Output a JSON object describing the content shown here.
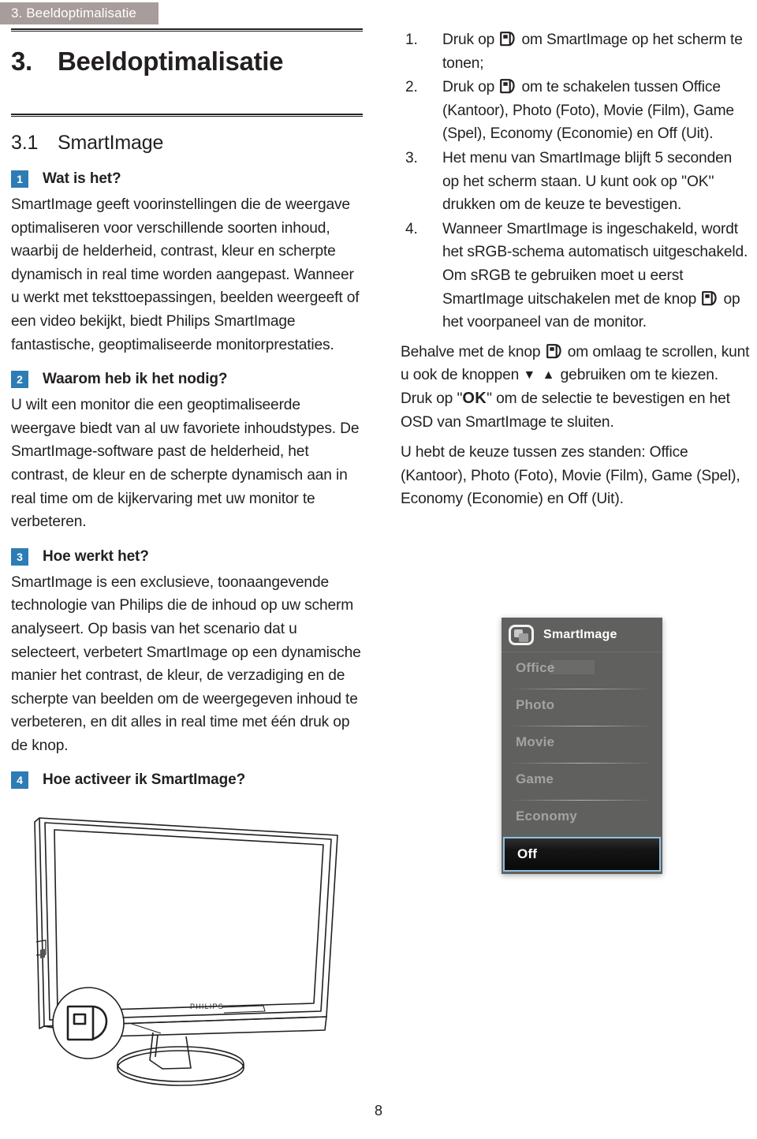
{
  "header": {
    "running_head": "3. Beeldoptimalisatie"
  },
  "headings": {
    "chapter_number": "3.",
    "chapter_title": "Beeldoptimalisatie",
    "section_number": "3.1",
    "section_title": "SmartImage"
  },
  "left_column": {
    "sections": [
      {
        "badge": "1",
        "title": "Wat is het?",
        "paragraphs": [
          "SmartImage geeft voorinstellingen die de weergave optimaliseren voor verschillende soorten inhoud, waarbij de helderheid, contrast, kleur en scherpte dynamisch in real time worden aangepast. Wanneer u werkt met teksttoepassingen, beelden weergeeft of een video bekijkt, biedt Philips SmartImage fantastische, geoptimaliseerde monitorprestaties."
        ]
      },
      {
        "badge": "2",
        "title": "Waarom heb ik het nodig?",
        "paragraphs": [
          "U wilt een monitor die een geoptimaliseerde weergave biedt van al uw favoriete inhoudstypes. De SmartImage-software past de helderheid, het contrast, de kleur en de scherpte dynamisch aan in real time om de kijkervaring met uw monitor te verbeteren."
        ]
      },
      {
        "badge": "3",
        "title": "Hoe werkt het?",
        "paragraphs": [
          "SmartImage is een exclusieve, toonaangevende technologie van Philips die de inhoud op uw scherm analyseert. Op basis van het scenario dat u selecteert, verbetert SmartImage op een dynamische manier het contrast, de kleur, de verzadiging en de scherpte van beelden om de weergegeven inhoud te verbeteren, en dit alles in real time met één druk op de knop."
        ]
      },
      {
        "badge": "4",
        "title": "Hoe activeer ik SmartImage?",
        "paragraphs": []
      }
    ],
    "monitor_brand": "PHILIPS"
  },
  "right_column": {
    "steps": [
      {
        "marker": "1.",
        "text_before_icon": "Druk op ",
        "text_after_icon": " om SmartImage op het scherm te tonen;"
      },
      {
        "marker": "2.",
        "text_before_icon": "Druk op ",
        "text_after_icon": " om te schakelen tussen Office (Kantoor), Photo (Foto), Movie (Film), Game (Spel), Economy (Economie) en Off (Uit)."
      },
      {
        "marker": "3.",
        "text_before_icon": "Het menu van SmartImage blijft 5 seconden op het scherm staan. U kunt ook op ''OK'' drukken om de keuze te bevestigen.",
        "text_after_icon": ""
      },
      {
        "marker": "4.",
        "text_before_icon": "Wanneer SmartImage is ingeschakeld, wordt het sRGB-schema automatisch uitgeschakeld. Om sRGB te gebruiken moet u eerst SmartImage uitschakelen met de knop ",
        "text_after_icon": " op het voorpaneel van de monitor."
      }
    ],
    "paragraph_scroll": {
      "part1": "Behalve met de knop ",
      "part2": " om omlaag te scrollen, kunt u ook de knoppen ",
      "arrows": "▼ ▲",
      "part3": " gebruiken om te kiezen. Druk op ''",
      "ok": "OK",
      "part4": "'' om de selectie te bevestigen en het OSD van SmartImage te sluiten."
    },
    "paragraph_modes": "U hebt de keuze tussen zes standen: Office (Kantoor), Photo (Foto), Movie (Film), Game (Spel), Economy (Economie) en Off (Uit)."
  },
  "osd": {
    "title": "SmartImage",
    "items": [
      {
        "label": "Office",
        "selected": false
      },
      {
        "label": "Photo",
        "selected": false
      },
      {
        "label": "Movie",
        "selected": false
      },
      {
        "label": "Game",
        "selected": false
      },
      {
        "label": "Economy",
        "selected": false
      },
      {
        "label": "Off",
        "selected": true
      }
    ],
    "colors": {
      "panel": "#60615f",
      "item_text": "#a3a3a3",
      "title_text": "#ffffff",
      "selected_border": "#8fc0e0",
      "selected_bg": "#0b0b0b"
    }
  },
  "footer": {
    "page_number": "8"
  },
  "colors": {
    "badge_blue": "#2e7cb5",
    "running_head_bg": "#a79d9a",
    "text": "#231f20"
  }
}
